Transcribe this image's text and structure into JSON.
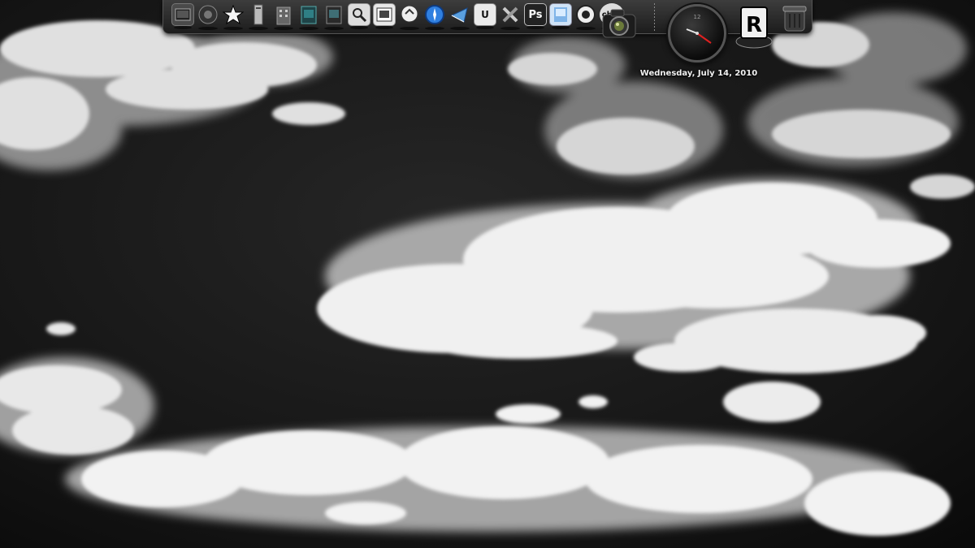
{
  "desktop": {
    "wallpaper": "black-and-white cloudy sky"
  },
  "dock": {
    "items": [
      {
        "name": "finder-icon",
        "label": ""
      },
      {
        "name": "system-preferences-icon",
        "label": ""
      },
      {
        "name": "star-icon",
        "label": ""
      },
      {
        "name": "server-icon",
        "label": ""
      },
      {
        "name": "building-icon",
        "label": ""
      },
      {
        "name": "folder-teal-icon",
        "label": ""
      },
      {
        "name": "folder-dark-icon",
        "label": ""
      },
      {
        "name": "preview-icon",
        "label": ""
      },
      {
        "name": "photo-icon",
        "label": ""
      },
      {
        "name": "ichat-icon",
        "label": ""
      },
      {
        "name": "safari-icon",
        "label": ""
      },
      {
        "name": "mail-icon",
        "label": ""
      },
      {
        "name": "utility-icon",
        "label": "U"
      },
      {
        "name": "tools-icon",
        "label": ""
      },
      {
        "name": "photoshop-icon",
        "label": "Ps"
      },
      {
        "name": "image-viewer-icon",
        "label": ""
      },
      {
        "name": "aperture-icon",
        "label": ""
      },
      {
        "name": "chat-bubble-icon",
        "label": "chat"
      }
    ],
    "camera_icon": "camera-icon",
    "rlogo_label": "R",
    "trash_icon": "trash-icon"
  },
  "clock": {
    "date_text": "Wednesday, July 14, 2010",
    "numeral_12": "12"
  },
  "colors": {
    "dock_bg": "#2a2a2a",
    "clock_hand": "#e02020",
    "safari_blue": "#2f7fe0"
  }
}
